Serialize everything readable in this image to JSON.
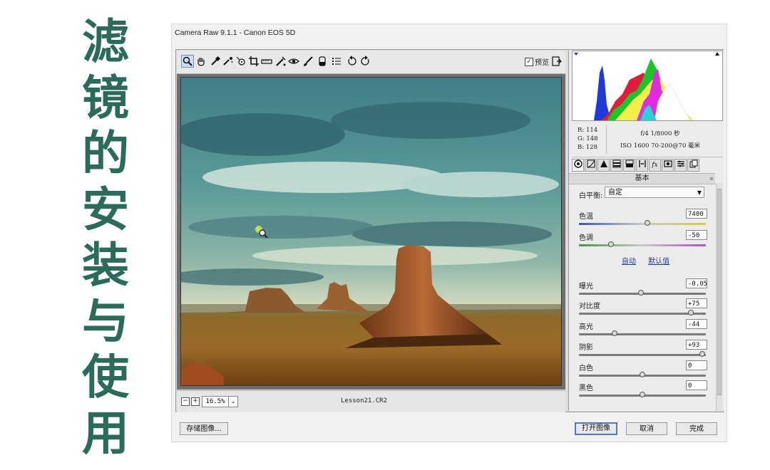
{
  "side_title": [
    "滤",
    "镜",
    "的",
    "安",
    "装",
    "与",
    "使",
    "用"
  ],
  "dialog": {
    "title": "Camera Raw 9.1.1 -  Canon EOS 5D"
  },
  "toolbar": {
    "tools": [
      "zoom-icon",
      "hand-icon",
      "white-balance-icon",
      "color-sampler-icon",
      "targeted-adjust-icon",
      "crop-icon",
      "straighten-icon",
      "spot-removal-icon",
      "red-eye-icon",
      "adjustment-brush-icon",
      "graduated-filter-icon",
      "preferences-icon",
      "rotate-left-icon",
      "rotate-right-icon"
    ],
    "preview_label": "预览",
    "preview_checked": "✓"
  },
  "statusbar": {
    "zoom_minus": "−",
    "zoom_plus": "+",
    "zoom_value": "16.5%",
    "zoom_dropdown": "⌄",
    "filename": "Lesson21.CR2"
  },
  "readout": {
    "r": "R:  114",
    "g": "G:  148",
    "b": "B:  128",
    "aperture_shutter": "f/4   1/8000 秒",
    "iso_lens": "ISO 1600   70-200@70 毫米"
  },
  "panel": {
    "tabs": [
      "basic",
      "tone-curve",
      "detail",
      "hsl",
      "split-toning",
      "lens",
      "fx",
      "camera-calibration",
      "presets",
      "snapshots"
    ],
    "section_title": "基本",
    "section_menu": "≡",
    "white_balance_label": "白平衡:",
    "white_balance_value": "自定",
    "auto_label": "自动",
    "default_label": "默认值"
  },
  "sliders": [
    {
      "key": "temp",
      "label": "色温",
      "value": "7400",
      "position": 0.54,
      "track": "linear-gradient(90deg,#3a57b8,#c9c9c9,#d8cc45)"
    },
    {
      "key": "tint",
      "label": "色调",
      "value": "-50",
      "position": 0.25,
      "track": "linear-gradient(90deg,#3f9c3f,#c9c9c9,#b34fc2)"
    },
    {
      "key": "exposure",
      "label": "曝光",
      "value": "-0.05",
      "position": 0.49,
      "track": "#7a7a7a"
    },
    {
      "key": "contrast",
      "label": "对比度",
      "value": "+75",
      "position": 0.88,
      "track": "#7a7a7a"
    },
    {
      "key": "highlights",
      "label": "高光",
      "value": "-44",
      "position": 0.28,
      "track": "#7a7a7a"
    },
    {
      "key": "shadows",
      "label": "阴影",
      "value": "+93",
      "position": 0.97,
      "track": "#7a7a7a"
    },
    {
      "key": "whites",
      "label": "白色",
      "value": "0",
      "position": 0.5,
      "track": "#7a7a7a"
    },
    {
      "key": "blacks",
      "label": "黑色",
      "value": "0",
      "position": 0.5,
      "track": "#7a7a7a"
    }
  ],
  "buttons": {
    "save": "存储图像...",
    "open": "打开图像",
    "cancel": "取消",
    "done": "完成"
  },
  "colors": {
    "title_green": "#2a6b5b",
    "primary_border": "#4a7bd0",
    "link_blue": "#1e3c96"
  }
}
